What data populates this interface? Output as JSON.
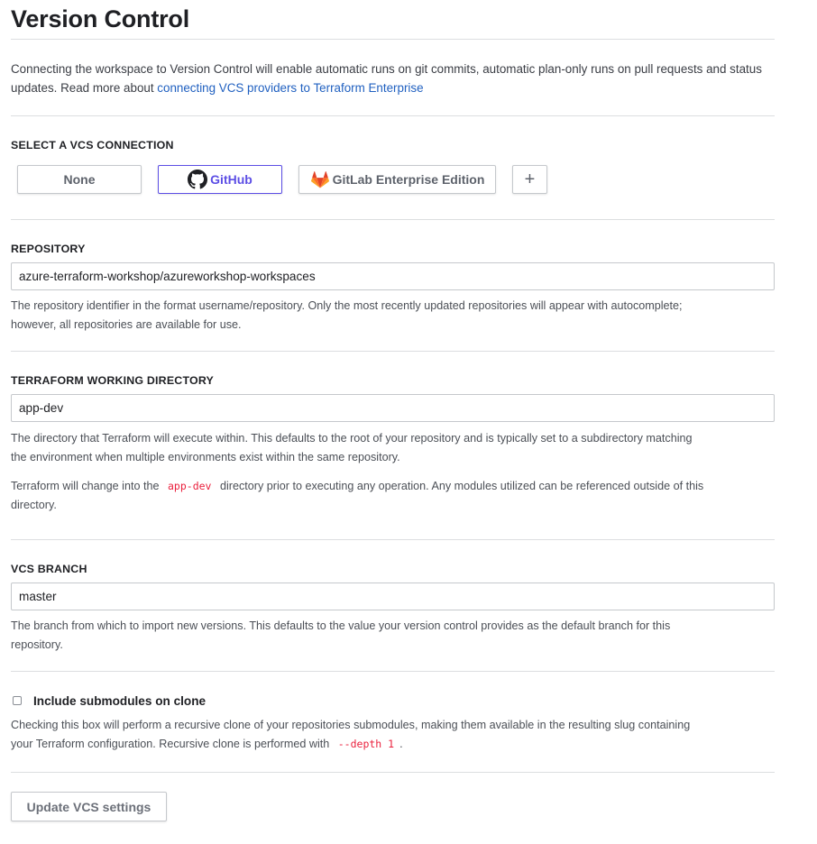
{
  "page": {
    "title": "Version Control",
    "intro_text": "Connecting the workspace to Version Control will enable automatic runs on git commits, automatic plan-only runs on pull requests and status updates. Read more about ",
    "intro_link": "connecting VCS providers to Terraform Enterprise"
  },
  "vcs_connection": {
    "label": "SELECT A VCS CONNECTION",
    "options": {
      "none": "None",
      "github": "GitHub",
      "gitlab": "GitLab Enterprise Edition",
      "add": "+"
    },
    "selected": "GitHub",
    "accent_color": "#5c4ee5"
  },
  "repository": {
    "label": "REPOSITORY",
    "value": "azure-terraform-workshop/azureworkshop-workspaces",
    "help_line1": "The repository identifier in the format username/repository. Only the most recently updated repositories will appear with autocomplete;",
    "help_line2": "however, all repositories are available for use."
  },
  "working_directory": {
    "label": "TERRAFORM WORKING DIRECTORY",
    "value": "app-dev",
    "help_line1": "The directory that Terraform will execute within. This defaults to the root of your repository and is typically set to a subdirectory matching",
    "help_line2": "the environment when multiple environments exist within the same repository.",
    "note_prefix": "Terraform will change into the",
    "note_code": "app-dev",
    "note_suffix": "directory prior to executing any operation. Any modules utilized can be referenced outside of this",
    "note_line2": "directory."
  },
  "vcs_branch": {
    "label": "VCS BRANCH",
    "value": "master",
    "help_line1": "The branch from which to import new versions. This defaults to the value your version control provides as the default branch for this",
    "help_line2": "repository."
  },
  "submodules": {
    "label": "Include submodules on clone",
    "checked": false,
    "help_line1": "Checking this box will perform a recursive clone of your repositories submodules, making them available in the resulting slug containing",
    "help_prefix2": "your Terraform configuration. Recursive clone is performed with",
    "help_code": "--depth 1",
    "help_suffix2": "."
  },
  "actions": {
    "submit_label": "Update VCS settings"
  }
}
